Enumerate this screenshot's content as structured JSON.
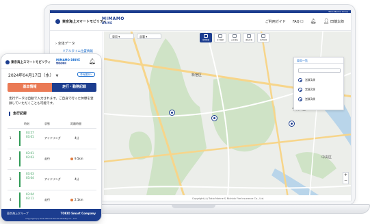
{
  "desktop": {
    "top_tag": "Tokio Marine Group",
    "org_name": "東京海上スマートモビリティ",
    "product_name": "MIMAMO",
    "product_sub": "DRIVE",
    "nav": {
      "guide": "ご利用ガイド",
      "faq": "FAQ",
      "user": "田端太郎"
    },
    "sidebar": {
      "section": "全体データ",
      "item": "リアルタイム位置情報"
    },
    "map": {
      "select_1": "車両",
      "select_2": "部署",
      "toolbar": [
        {
          "label": "位置情報",
          "active": true
        },
        {
          "label": "走行履歴",
          "active": false
        },
        {
          "label": "安全運転",
          "active": false
        },
        {
          "label": "運転日報",
          "active": false
        },
        {
          "label": "車両管理",
          "active": false
        }
      ],
      "labels": [
        "新宿区",
        "千代田区",
        "中央区"
      ],
      "panel_title": "車両一覧",
      "panel_sub": "営業1課 / 営業2課",
      "panel_items": [
        "営業1課",
        "営業2課",
        "営業3課"
      ],
      "zoom_in": "+",
      "zoom_out": "−",
      "copyright": "Copyright (c) Tokio Marine & Nichido Fire Insurance Co., Ltd."
    }
  },
  "mobile": {
    "org_name": "東京海上スマートモビリティ",
    "product_name": "MIMAMO DRIVE",
    "product_sub": "管理者専用",
    "date": "2024年04月17日（水）",
    "caret": "▼",
    "pill": "車両選択へ",
    "tabs": [
      "基本情報",
      "走行・勤務記録"
    ],
    "note": "走行データは自動で入力されます。ご自身で行った休憩を登録していただくことも可能です。",
    "section_title": "走行記録",
    "table_headers": [
      "時刻",
      "状態",
      "距離時間"
    ],
    "rows": [
      {
        "num": "1",
        "time1": "03:57",
        "time2": "03:01",
        "status": "アイドリング",
        "dot": "#9aa0a8",
        "value": "4分"
      },
      {
        "num": "2",
        "time1": "03:01",
        "time2": "03:03",
        "status": "走行",
        "dot": "#e07a3c",
        "value": "9.5km"
      },
      {
        "num": "3",
        "time1": "03:03",
        "time2": "03:04",
        "status": "アイドリング",
        "dot": "#9aa0a8",
        "value": "4分"
      },
      {
        "num": "4",
        "time1": "03:04",
        "time2": "03:11",
        "status": "走行",
        "dot": "#e07a3c",
        "value": "2.1km"
      }
    ],
    "footer_left": "東京海上グループ",
    "footer_right": "TOKIO Smart Company",
    "footer_copy": "Copyright (c) Tokio Marine Smart Mobility Co., Ltd."
  }
}
